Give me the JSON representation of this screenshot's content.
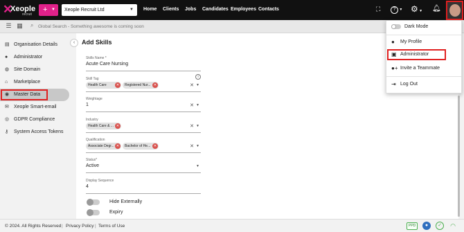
{
  "brand": {
    "logo_text": "Xeople",
    "logo_sub": "recruit",
    "accent": "#e0218a",
    "highlight": "#e02020"
  },
  "header": {
    "plus_label": "+",
    "company": "Xeople Recruit Ltd",
    "nav": [
      "Home",
      "Clients",
      "Jobs",
      "Candidates",
      "Employees",
      "Contacts"
    ],
    "icons": [
      "fullscreen-icon",
      "help-icon",
      "settings-icon",
      "bell-icon",
      "avatar"
    ]
  },
  "search": {
    "placeholder": "Global Search - Something awesome is coming soon"
  },
  "sidebar": {
    "items": [
      {
        "label": "Organisation Details",
        "icon": "building-icon"
      },
      {
        "label": "Administrator",
        "icon": "person-icon"
      },
      {
        "label": "Site Domain",
        "icon": "globe-icon"
      },
      {
        "label": "Marketplace",
        "icon": "store-icon"
      },
      {
        "label": "Master Data",
        "icon": "database-icon",
        "active": true
      },
      {
        "label": "Xeople Smart-email",
        "icon": "email-icon"
      },
      {
        "label": "GDPR Compliance",
        "icon": "gdpr-icon"
      },
      {
        "label": "System Access Tokens",
        "icon": "key-icon"
      }
    ]
  },
  "form": {
    "title": "Add Skills",
    "skills_name": {
      "label": "Skills Name *",
      "value": "Acute Care Nursing"
    },
    "skill_tag": {
      "label": "Skill Tag",
      "chips": [
        "Health Care",
        "Registered Nur..."
      ]
    },
    "weightage": {
      "label": "Weightage",
      "value": "1"
    },
    "industry": {
      "label": "Industry",
      "chips": [
        "Health Care & ..."
      ]
    },
    "qualification": {
      "label": "Qualification",
      "chips": [
        "Associate Degr...",
        "Bachelor of He..."
      ]
    },
    "status": {
      "label": "Status*",
      "value": "Active"
    },
    "display_sequence": {
      "label": "Display Sequence",
      "value": "4"
    },
    "toggles": [
      "Hide Externally",
      "Expiry"
    ]
  },
  "profile_menu": {
    "dark_mode": "Dark Mode",
    "items": [
      "My Profile",
      "Administrator",
      "Invite a Teammate",
      "Log Out"
    ]
  },
  "footer": {
    "copyright": "© 2024. All Rights Reserved",
    "links": [
      "Privacy Policy",
      "Terms of Use"
    ],
    "badge": "PPD"
  }
}
